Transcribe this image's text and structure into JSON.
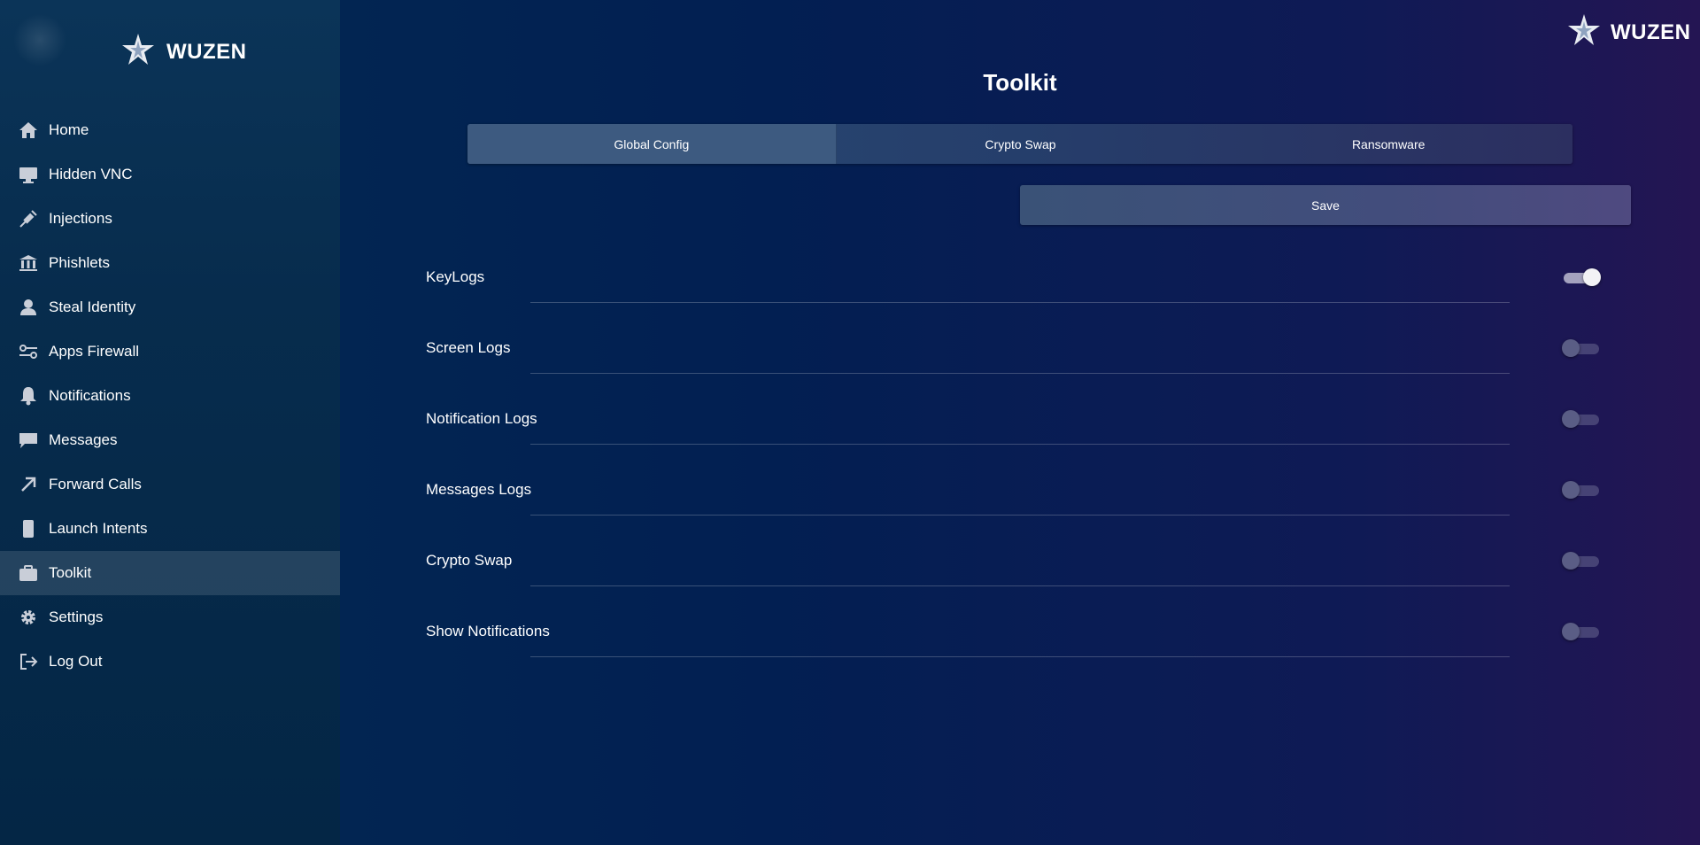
{
  "brand": {
    "name": "WUZEN"
  },
  "sidebar": {
    "items": [
      {
        "label": "Home",
        "icon": "home-icon",
        "active": false
      },
      {
        "label": "Hidden VNC",
        "icon": "monitor-icon",
        "active": false
      },
      {
        "label": "Injections",
        "icon": "syringe-icon",
        "active": false
      },
      {
        "label": "Phishlets",
        "icon": "bank-icon",
        "active": false
      },
      {
        "label": "Steal Identity",
        "icon": "user-icon",
        "active": false
      },
      {
        "label": "Apps Firewall",
        "icon": "sliders-icon",
        "active": false
      },
      {
        "label": "Notifications",
        "icon": "bell-icon",
        "active": false
      },
      {
        "label": "Messages",
        "icon": "message-icon",
        "active": false
      },
      {
        "label": "Forward Calls",
        "icon": "arrow-up-right-icon",
        "active": false
      },
      {
        "label": "Launch Intents",
        "icon": "phone-icon",
        "active": false
      },
      {
        "label": "Toolkit",
        "icon": "briefcase-icon",
        "active": true
      },
      {
        "label": "Settings",
        "icon": "gear-icon",
        "active": false
      },
      {
        "label": "Log Out",
        "icon": "logout-icon",
        "active": false
      }
    ]
  },
  "main": {
    "title": "Toolkit",
    "tabs": [
      {
        "label": "Global Config",
        "active": true
      },
      {
        "label": "Crypto Swap",
        "active": false
      },
      {
        "label": "Ransomware",
        "active": false
      }
    ],
    "save_label": "Save",
    "settings": [
      {
        "label": "KeyLogs",
        "enabled": true
      },
      {
        "label": "Screen Logs",
        "enabled": false
      },
      {
        "label": "Notification Logs",
        "enabled": false
      },
      {
        "label": "Messages Logs",
        "enabled": false
      },
      {
        "label": "Crypto Swap",
        "enabled": false
      },
      {
        "label": "Show Notifications",
        "enabled": false
      }
    ]
  },
  "colors": {
    "background_left": "#022a52",
    "background_right": "#241553",
    "sidebar": "#072c4d",
    "active_tab": "#3d5a80"
  }
}
